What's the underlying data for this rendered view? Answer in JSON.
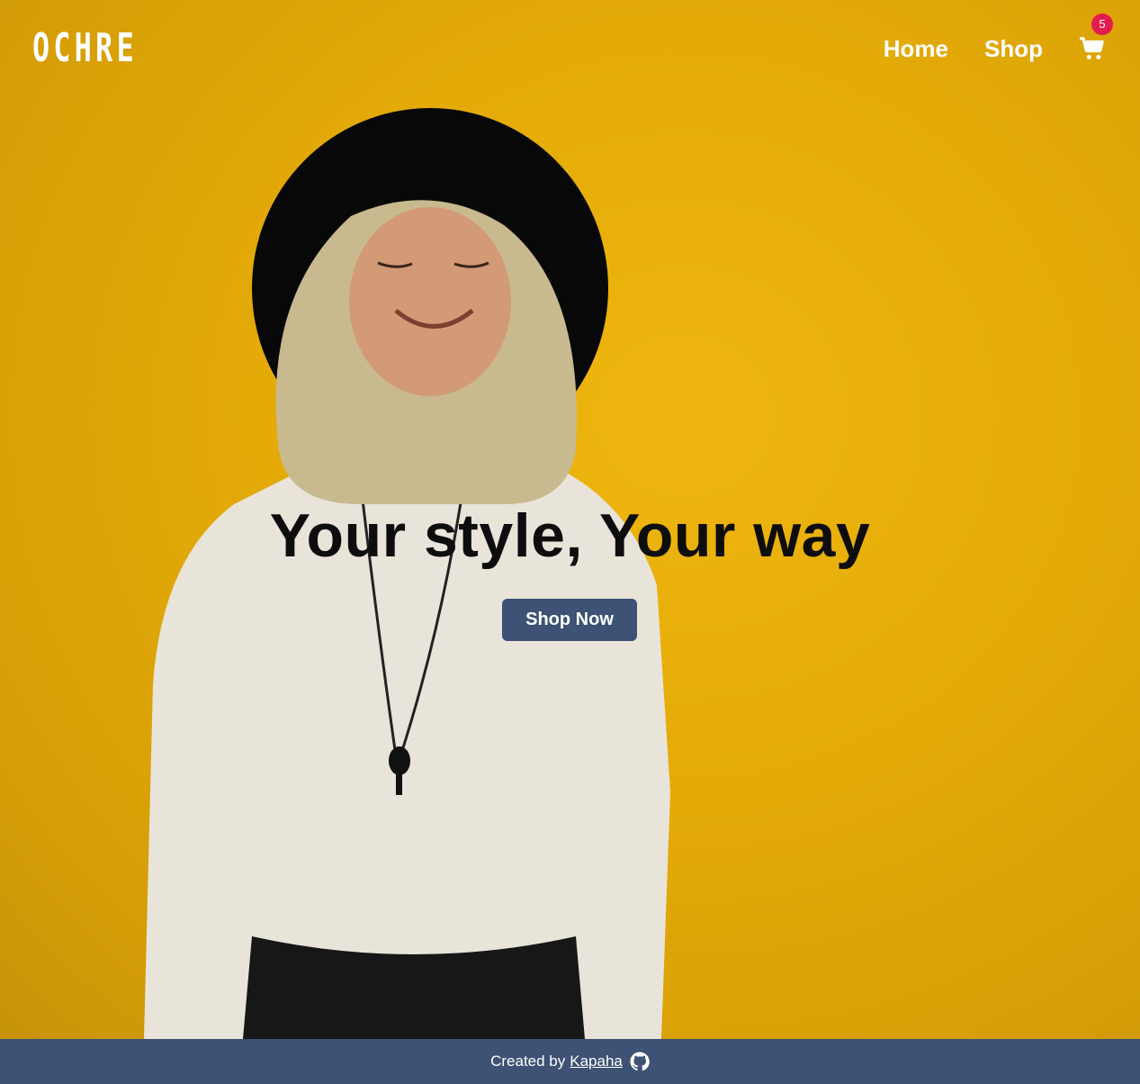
{
  "brand": {
    "logo": "OCHRE"
  },
  "nav": {
    "home": "Home",
    "shop": "Shop",
    "cart_icon": "shopping-cart-icon",
    "cart_count": "5"
  },
  "hero": {
    "headline": "Your style, Your way",
    "cta": "Shop Now",
    "image": "woman-in-black-hat-and-white-sweater-on-yellow-wall"
  },
  "footer": {
    "prefix": "Created by",
    "author": "Kapaha",
    "icon": "github-icon"
  },
  "colors": {
    "accent": "#3d5274",
    "badge": "#e31c4f",
    "background": "#e2ad0c"
  }
}
